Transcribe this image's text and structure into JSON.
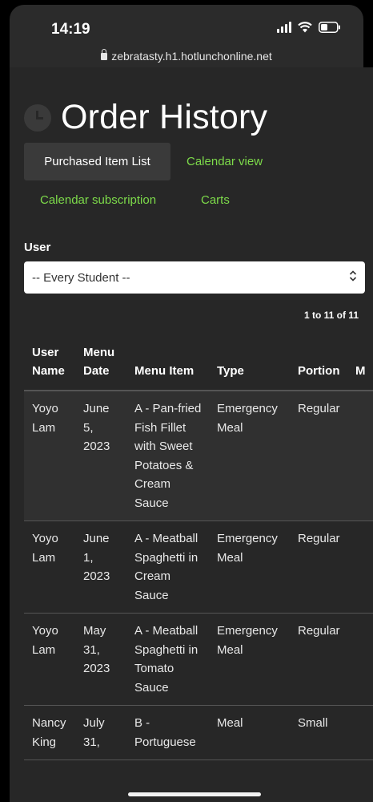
{
  "status_bar": {
    "time": "14:19"
  },
  "browser": {
    "url": "zebratasty.h1.hotlunchonline.net"
  },
  "page": {
    "title": "Order History",
    "tabs": [
      {
        "label": "Purchased Item List",
        "active": true
      },
      {
        "label": "Calendar view",
        "active": false
      },
      {
        "label": "Calendar subscription",
        "active": false
      },
      {
        "label": "Carts",
        "active": false
      }
    ]
  },
  "filter": {
    "user_label": "User",
    "user_select_value": "-- Every Student --"
  },
  "pagination": {
    "summary": "1 to 11 of 11"
  },
  "table": {
    "headers": [
      "User Name",
      "Menu Date",
      "Menu Item",
      "Type",
      "Portion",
      "M"
    ],
    "rows": [
      {
        "user": "Yoyo Lam",
        "date": "June 5, 2023",
        "item": "A - Pan-fried Fish Fillet with Sweet Potatoes & Cream Sauce",
        "type": "Emergency Meal",
        "portion": "Regular"
      },
      {
        "user": "Yoyo Lam",
        "date": "June 1, 2023",
        "item": "A - Meatball Spaghetti in Cream Sauce",
        "type": "Emergency Meal",
        "portion": "Regular"
      },
      {
        "user": "Yoyo Lam",
        "date": "May 31, 2023",
        "item": "A - Meatball Spaghetti in Tomato Sauce",
        "type": "Emergency Meal",
        "portion": "Regular"
      },
      {
        "user": "Nancy King",
        "date": "July 31,",
        "item": "B - Portuguese",
        "type": "Meal",
        "portion": "Small"
      }
    ]
  },
  "colors": {
    "link": "#7ddb4a",
    "panel": "#272727",
    "active_tab": "#3a3a3a"
  }
}
